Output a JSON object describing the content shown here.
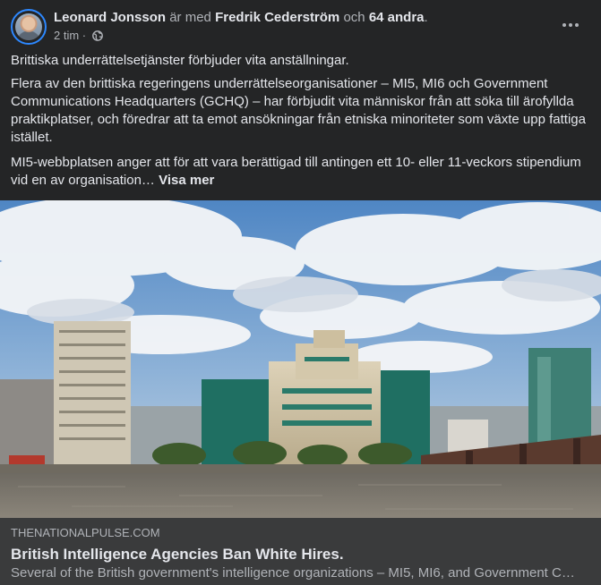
{
  "post": {
    "author": "Leonard Jonsson",
    "with_text": "är med",
    "tagged_person": "Fredrik Cederström",
    "and_text": "och",
    "others": "64 andra",
    "period": ".",
    "time": "2 tim",
    "separator": "·",
    "paragraphs": [
      "Brittiska underrättelsetjänster förbjuder vita anställningar.",
      "Flera av den brittiska regeringens underrättelseorganisationer – MI5, MI6 och Government Communications Headquarters (GCHQ) – har förbjudit vita människor från att söka till ärofyllda praktikplatser, och föredrar att ta emot ansökningar från etniska minoriteter som växte upp fattiga istället.",
      "MI5-webbplatsen anger att för att vara berättigad till antingen ett 10- eller 11-veckors stipendium vid en av organisation…"
    ],
    "see_more": "Visa mer"
  },
  "link_preview": {
    "domain": "THENATIONALPULSE.COM",
    "title": "British Intelligence Agencies Ban White Hires.",
    "description": "Several of the British government's intelligence organizations – MI5, MI6, and Government C…"
  },
  "icons": {
    "privacy": "globe-icon",
    "menu": "more-options-icon"
  },
  "colors": {
    "background": "#242526",
    "link_box": "#3a3b3c",
    "primary_text": "#e4e6eb",
    "secondary_text": "#b0b3b8",
    "avatar_ring": "#2d88ff"
  }
}
